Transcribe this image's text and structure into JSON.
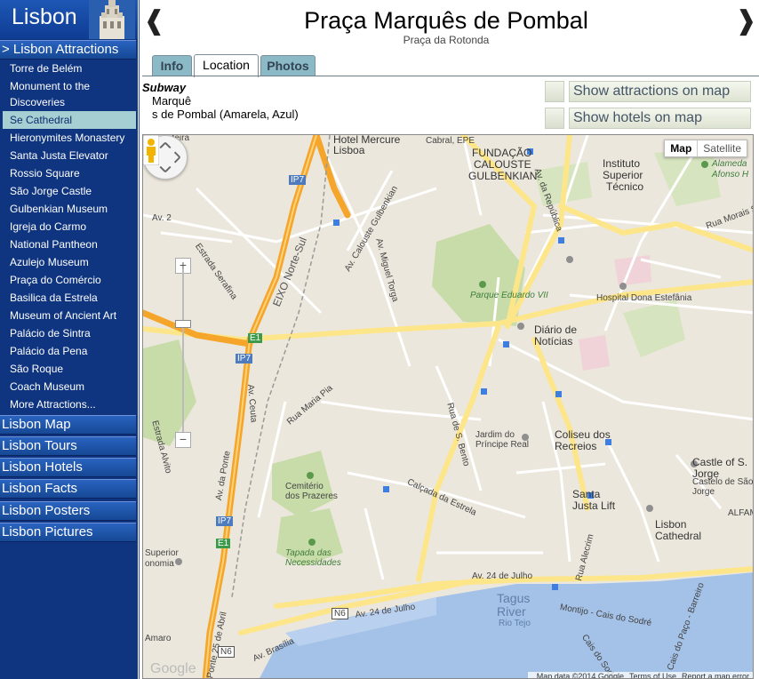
{
  "sidebar": {
    "brand": "Lisbon",
    "attractions_header": "> Lisbon Attractions",
    "items": [
      {
        "label": "Torre de Belém"
      },
      {
        "label": "Monument to the Discoveries"
      },
      {
        "label": "Se Cathedral"
      },
      {
        "label": "Hieronymites Monastery"
      },
      {
        "label": "Santa Justa Elevator"
      },
      {
        "label": "Rossio Square"
      },
      {
        "label": "São Jorge Castle"
      },
      {
        "label": "Gulbenkian Museum"
      },
      {
        "label": "Igreja do Carmo"
      },
      {
        "label": "National Pantheon"
      },
      {
        "label": "Azulejo Museum"
      },
      {
        "label": "Praça do Comércio"
      },
      {
        "label": "Basilica da Estrela"
      },
      {
        "label": "Museum of Ancient Art"
      },
      {
        "label": "Palácio de Sintra"
      },
      {
        "label": "Palácio da Pena"
      },
      {
        "label": "São Roque"
      },
      {
        "label": "Coach Museum"
      },
      {
        "label": "More Attractions..."
      }
    ],
    "sections": [
      {
        "label": "Lisbon Map"
      },
      {
        "label": "Lisbon Tours"
      },
      {
        "label": "Lisbon Hotels"
      },
      {
        "label": "Lisbon Facts"
      },
      {
        "label": "Lisbon Posters"
      },
      {
        "label": "Lisbon Pictures"
      }
    ]
  },
  "header": {
    "prev_glyph": "❰",
    "next_glyph": "❱",
    "title": "Praça Marquês de Pombal",
    "subtitle": "Praça da Rotonda"
  },
  "tabs": [
    {
      "label": "Info"
    },
    {
      "label": "Location"
    },
    {
      "label": "Photos"
    }
  ],
  "subway": {
    "heading": "Subway",
    "line1": "Marquê",
    "line2": "s de Pombal (Amarela, Azul)"
  },
  "buttons": {
    "show_attractions": "Show attractions on map",
    "show_hotels": "Show hotels on map"
  },
  "map": {
    "type_map": "Map",
    "type_satellite": "Satellite",
    "zoom_in": "+",
    "zoom_out": "−",
    "logo": "Google",
    "attribution": [
      "Map data ©2014 Google",
      "Terms of Use",
      "Report a map error"
    ],
    "labels": {
      "fronteira": "Fronteira",
      "hotel_mercure": "Hotel Mercure",
      "lisboa": "Lisboa",
      "cabral_epe": "Cabral, EPE",
      "fundacao": "FUNDAÇÃO",
      "calouste": "CALOUSTE",
      "gulbenkian": "GULBENKIAN",
      "av_republica": "Av. da República",
      "instituto": "Instituto",
      "superior": "Superior",
      "tecnico": "Técnico",
      "alameda": "Alameda",
      "afonso": "Afonso H",
      "av2": "Av. 2",
      "ip7_top": "IP7",
      "eixo": "EIXO Norte-Sul",
      "av_calouste": "Av. Calouste Gulbenkian",
      "estrada_serafina": "Estrada Serafina",
      "av_miguel_torga": "Av. Miguel Torga",
      "rua_morais": "Rua Morais S",
      "parque_eduardo": "Parque Eduardo VII",
      "hospital": "Hospital Dona Estefânia",
      "e1_top": "E1",
      "ip7_mid": "IP7",
      "diario": "Diário de Notícias",
      "rua_maria_pia": "Rua Maria Pia",
      "av_ceuta": "Av. Ceuta",
      "estrada_alvito": "Estrada Alvito",
      "rua_s_bento": "Rua de S. Bento",
      "jardim": "Jardim do Príncipe Real",
      "coliseu": "Coliseu dos Recreios",
      "castle": "Castle of S. Jorge",
      "castelo": "Castelo de São Jorge",
      "cemiterio": "Cemitério dos Prazeres",
      "calcada": "Calçada da Estrela",
      "santa_justa": "Santa Justa Lift",
      "alfama": "ALFAMA",
      "ip7_low": "IP7",
      "e1_low": "E1",
      "av_ponte": "Av. da Ponte",
      "tapada": "Tapada das Necessidades",
      "rua_alecrim": "Rua Alecrim",
      "lisbon_cathedral": "Lisbon Cathedral",
      "av_24_julho_top": "Av. 24 de Julho",
      "tagus": "Tagus River",
      "rio_tejo": "Rio Tejo",
      "n6_mid": "N6",
      "av_24_julho_low": "Av. 24 de Julho",
      "montijo": "Montijo - Cais do Sodré",
      "cais_sodre": "Cais do Sodré",
      "cais_paco": "Cais do Paço - Barreiro",
      "ponte_25": "Ponte 25 de Abril",
      "av_brasilia": "Av. Brasília",
      "amaro": "Amaro",
      "n6_low": "N6",
      "onomia": "onomia",
      "superior_l": "Superior"
    }
  },
  "colors": {
    "sidebar_bg": "#0f3580",
    "active_item_bg": "#a6cfd3",
    "tab_bg": "#8bb9c5",
    "map_land": "#ece7dc",
    "map_water": "#a4c2e8",
    "map_park": "#c8dcaa",
    "highway": "#f4a52a",
    "main_road": "#fde68a"
  }
}
